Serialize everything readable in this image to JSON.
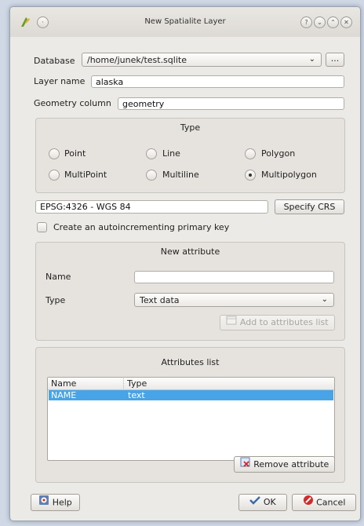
{
  "window": {
    "title": "New Spatialite Layer"
  },
  "titlebar_buttons": [
    "?",
    "⌄",
    "⌃",
    "✕"
  ],
  "database": {
    "label": "Database",
    "value": "/home/junek/test.sqlite",
    "browse_label": "..."
  },
  "layer_name": {
    "label": "Layer name",
    "value": "alaska"
  },
  "geometry_column": {
    "label": "Geometry column",
    "value": "geometry"
  },
  "type_group": {
    "title": "Type",
    "options": [
      "Point",
      "Line",
      "Polygon",
      "MultiPoint",
      "Multiline",
      "Multipolygon"
    ],
    "selected": "Multipolygon"
  },
  "crs": {
    "value": "EPSG:4326 - WGS 84",
    "button_label": "Specify CRS"
  },
  "primary_key": {
    "label": "Create an autoincrementing primary key",
    "checked": false
  },
  "new_attribute": {
    "title": "New attribute",
    "name_label": "Name",
    "name_value": "",
    "type_label": "Type",
    "type_value": "Text data",
    "add_button_label": "Add to attributes list"
  },
  "attributes_list": {
    "title": "Attributes list",
    "columns": [
      "Name",
      "Type"
    ],
    "rows": [
      {
        "name": "NAME",
        "type": "text"
      }
    ],
    "remove_button_label": "Remove attribute"
  },
  "footer": {
    "help_label": "Help",
    "ok_label": "OK",
    "cancel_label": "Cancel"
  },
  "colors": {
    "selection": "#48a4e6",
    "window_bg": "#eceae6"
  }
}
